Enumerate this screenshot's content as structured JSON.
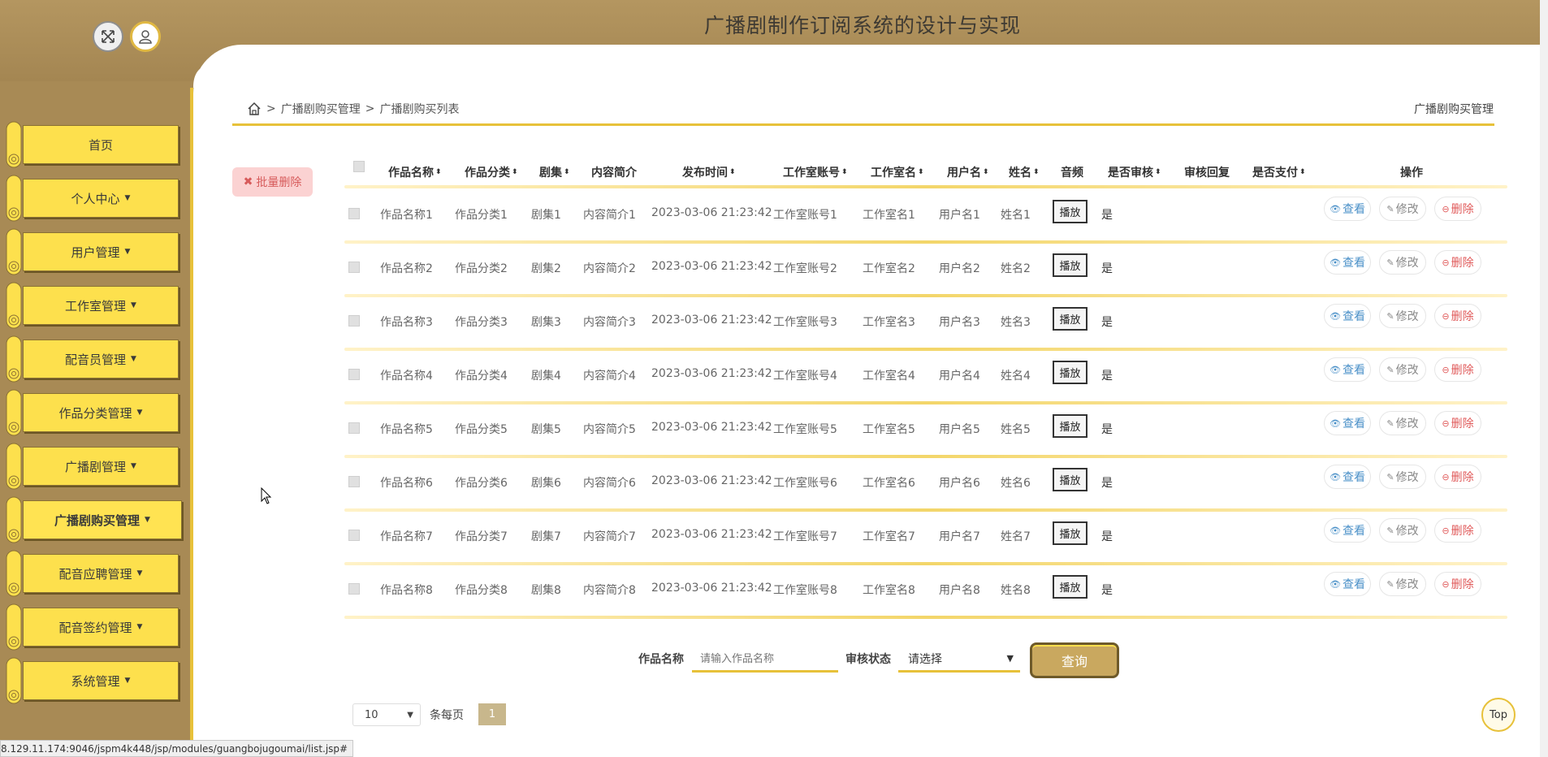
{
  "header": {
    "title": "广播剧制作订阅系统的设计与实现"
  },
  "sidebar": {
    "items": [
      {
        "label": "首页",
        "caret": ""
      },
      {
        "label": "个人中心",
        "caret": "▼"
      },
      {
        "label": "用户管理",
        "caret": "▼"
      },
      {
        "label": "工作室管理",
        "caret": "▼"
      },
      {
        "label": "配音员管理",
        "caret": "▼"
      },
      {
        "label": "作品分类管理",
        "caret": "▼"
      },
      {
        "label": "广播剧管理",
        "caret": "▼"
      },
      {
        "label": "广播剧购买管理",
        "caret": "▼"
      },
      {
        "label": "配音应聘管理",
        "caret": "▼"
      },
      {
        "label": "配音签约管理",
        "caret": "▼"
      },
      {
        "label": "系统管理",
        "caret": "▼"
      }
    ]
  },
  "breadcrumb": {
    "sep1": ">",
    "level1": "广播剧购买管理",
    "sep2": ">",
    "level2": "广播剧购买列表",
    "right": "广播剧购买管理"
  },
  "actions": {
    "batch_delete": "批量删除"
  },
  "table": {
    "headers": [
      "作品名称",
      "作品分类",
      "剧集",
      "内容简介",
      "发布时间",
      "工作室账号",
      "工作室名",
      "用户名",
      "姓名",
      "音频",
      "是否审核",
      "审核回复",
      "是否支付",
      "操作"
    ],
    "sort_glyph": "⬍",
    "play_label": "播放",
    "view_label": "查看",
    "edit_label": "修改",
    "delete_label": "删除",
    "rows": [
      {
        "name": "作品名称1",
        "category": "作品分类1",
        "episode": "剧集1",
        "intro": "内容简介1",
        "time": "2023-03-06 21:23:42",
        "studio_account": "工作室账号1",
        "studio_name": "工作室名1",
        "username": "用户名1",
        "realname": "姓名1",
        "reviewed": "是",
        "reply": "",
        "paid": ""
      },
      {
        "name": "作品名称2",
        "category": "作品分类2",
        "episode": "剧集2",
        "intro": "内容简介2",
        "time": "2023-03-06 21:23:42",
        "studio_account": "工作室账号2",
        "studio_name": "工作室名2",
        "username": "用户名2",
        "realname": "姓名2",
        "reviewed": "是",
        "reply": "",
        "paid": ""
      },
      {
        "name": "作品名称3",
        "category": "作品分类3",
        "episode": "剧集3",
        "intro": "内容简介3",
        "time": "2023-03-06 21:23:42",
        "studio_account": "工作室账号3",
        "studio_name": "工作室名3",
        "username": "用户名3",
        "realname": "姓名3",
        "reviewed": "是",
        "reply": "",
        "paid": ""
      },
      {
        "name": "作品名称4",
        "category": "作品分类4",
        "episode": "剧集4",
        "intro": "内容简介4",
        "time": "2023-03-06 21:23:42",
        "studio_account": "工作室账号4",
        "studio_name": "工作室名4",
        "username": "用户名4",
        "realname": "姓名4",
        "reviewed": "是",
        "reply": "",
        "paid": ""
      },
      {
        "name": "作品名称5",
        "category": "作品分类5",
        "episode": "剧集5",
        "intro": "内容简介5",
        "time": "2023-03-06 21:23:42",
        "studio_account": "工作室账号5",
        "studio_name": "工作室名5",
        "username": "用户名5",
        "realname": "姓名5",
        "reviewed": "是",
        "reply": "",
        "paid": ""
      },
      {
        "name": "作品名称6",
        "category": "作品分类6",
        "episode": "剧集6",
        "intro": "内容简介6",
        "time": "2023-03-06 21:23:42",
        "studio_account": "工作室账号6",
        "studio_name": "工作室名6",
        "username": "用户名6",
        "realname": "姓名6",
        "reviewed": "是",
        "reply": "",
        "paid": ""
      },
      {
        "name": "作品名称7",
        "category": "作品分类7",
        "episode": "剧集7",
        "intro": "内容简介7",
        "time": "2023-03-06 21:23:42",
        "studio_account": "工作室账号7",
        "studio_name": "工作室名7",
        "username": "用户名7",
        "realname": "姓名7",
        "reviewed": "是",
        "reply": "",
        "paid": ""
      },
      {
        "name": "作品名称8",
        "category": "作品分类8",
        "episode": "剧集8",
        "intro": "内容简介8",
        "time": "2023-03-06 21:23:42",
        "studio_account": "工作室账号8",
        "studio_name": "工作室名8",
        "username": "用户名8",
        "realname": "姓名8",
        "reviewed": "是",
        "reply": "",
        "paid": ""
      }
    ]
  },
  "search": {
    "name_label": "作品名称",
    "name_placeholder": "请输入作品名称",
    "status_label": "审核状态",
    "status_value": "请选择",
    "query_button": "查询"
  },
  "pagination": {
    "page_size": "10",
    "page_size_label": "条每页",
    "current_page": "1"
  },
  "top_button": "Top",
  "status_bar": {
    "url": "8.129.11.174:9046/jspm4k448/jsp/modules/guangbojugoumai/list.jsp#"
  },
  "colors": {
    "brown": "#a88a55",
    "yellow": "#fde04d",
    "gold": "#e7c13a",
    "delete_red": "#e05a5a",
    "view_blue": "#4a90c8"
  },
  "icons": [
    "expand-icon",
    "user-icon",
    "home-icon",
    "close-x-icon",
    "eye-icon",
    "pen-icon",
    "minus-circle-icon",
    "sort-icon",
    "chevron-down-icon",
    "scroll-icon"
  ]
}
